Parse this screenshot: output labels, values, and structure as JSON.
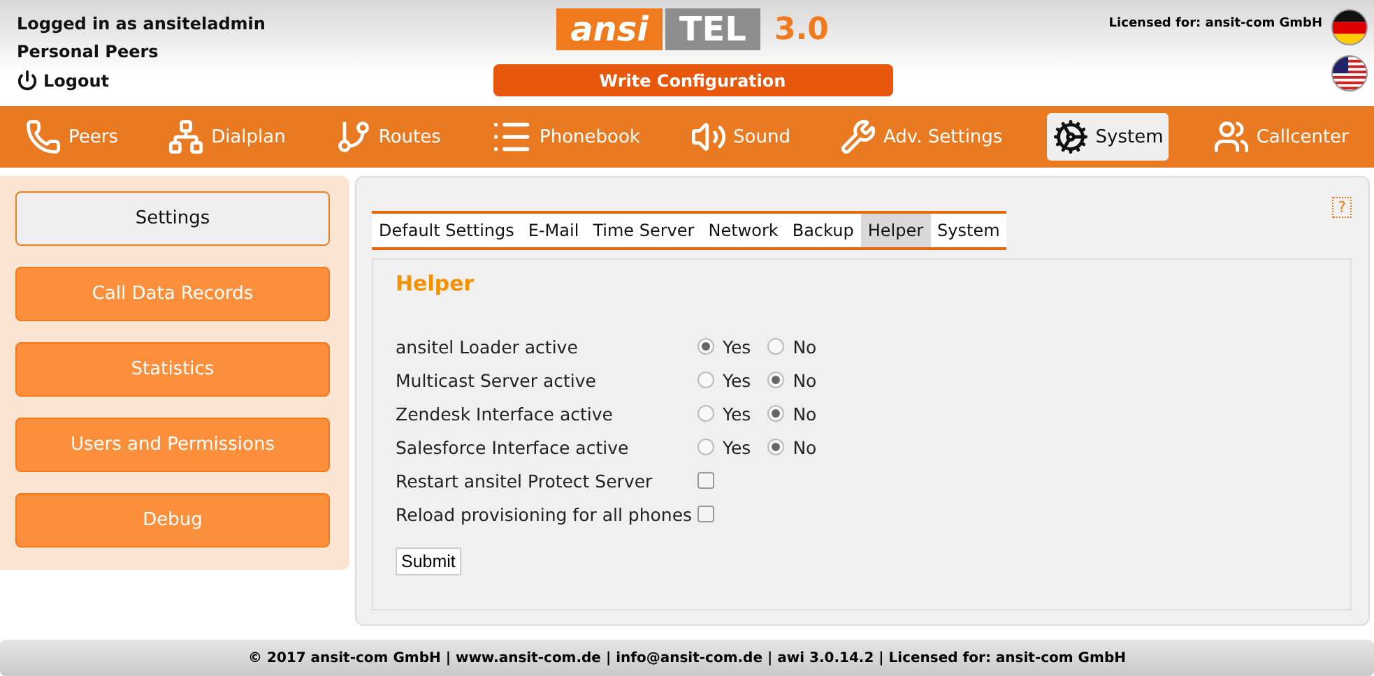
{
  "header": {
    "user": "Logged in as ansiteladmin",
    "context": "Personal Peers",
    "logout": "Logout",
    "logo": {
      "part_1": "ansi",
      "part_2": "TEL",
      "version": "3.0"
    },
    "write_button": "Write Configuration",
    "license": "Licensed for: ansit-com GmbH"
  },
  "nav": [
    {
      "label": "Peers",
      "kind": "phone",
      "selected": false
    },
    {
      "label": "Dialplan",
      "kind": "tree",
      "selected": false
    },
    {
      "label": "Routes",
      "kind": "branch",
      "selected": false
    },
    {
      "label": "Phonebook",
      "kind": "list",
      "selected": false
    },
    {
      "label": "Sound",
      "kind": "sound",
      "selected": false
    },
    {
      "label": "Adv. Settings",
      "kind": "wrench",
      "selected": false
    },
    {
      "label": "System",
      "kind": "gears",
      "selected": true
    },
    {
      "label": "Callcenter",
      "kind": "users",
      "selected": false
    }
  ],
  "sidebar": [
    {
      "label": "Settings",
      "selected": true
    },
    {
      "label": "Call Data Records",
      "selected": false
    },
    {
      "label": "Statistics",
      "selected": false
    },
    {
      "label": "Users and Permissions",
      "selected": false
    },
    {
      "label": "Debug",
      "selected": false
    }
  ],
  "help": "?",
  "tabs": [
    {
      "label": "Default Settings",
      "selected": false
    },
    {
      "label": "E-Mail",
      "selected": false
    },
    {
      "label": "Time Server",
      "selected": false
    },
    {
      "label": "Network",
      "selected": false
    },
    {
      "label": "Backup",
      "selected": false
    },
    {
      "label": "Helper",
      "selected": true
    },
    {
      "label": "System",
      "selected": false
    }
  ],
  "form": {
    "title": "Helper",
    "rows": [
      {
        "kind": "radio",
        "label": "ansitel Loader active",
        "yes": "Yes",
        "no": "No",
        "on": true
      },
      {
        "kind": "radio",
        "label": "Multicast Server active",
        "yes": "Yes",
        "no": "No",
        "on": false
      },
      {
        "kind": "radio",
        "label": "Zendesk Interface active",
        "yes": "Yes",
        "no": "No",
        "on": false
      },
      {
        "kind": "radio",
        "label": "Salesforce Interface active",
        "yes": "Yes",
        "no": "No",
        "on": false
      },
      {
        "kind": "checkbox",
        "label": "Restart ansitel Protect Server",
        "checked": false
      },
      {
        "kind": "checkbox",
        "label": "Reload provisioning for all phones",
        "checked": false
      }
    ],
    "submit": "Submit"
  },
  "footer": "© 2017 ansit-com GmbH | www.ansit-com.de | info@ansit-com.de | awi 3.0.14.2 | Licensed for: ansit-com GmbH"
}
